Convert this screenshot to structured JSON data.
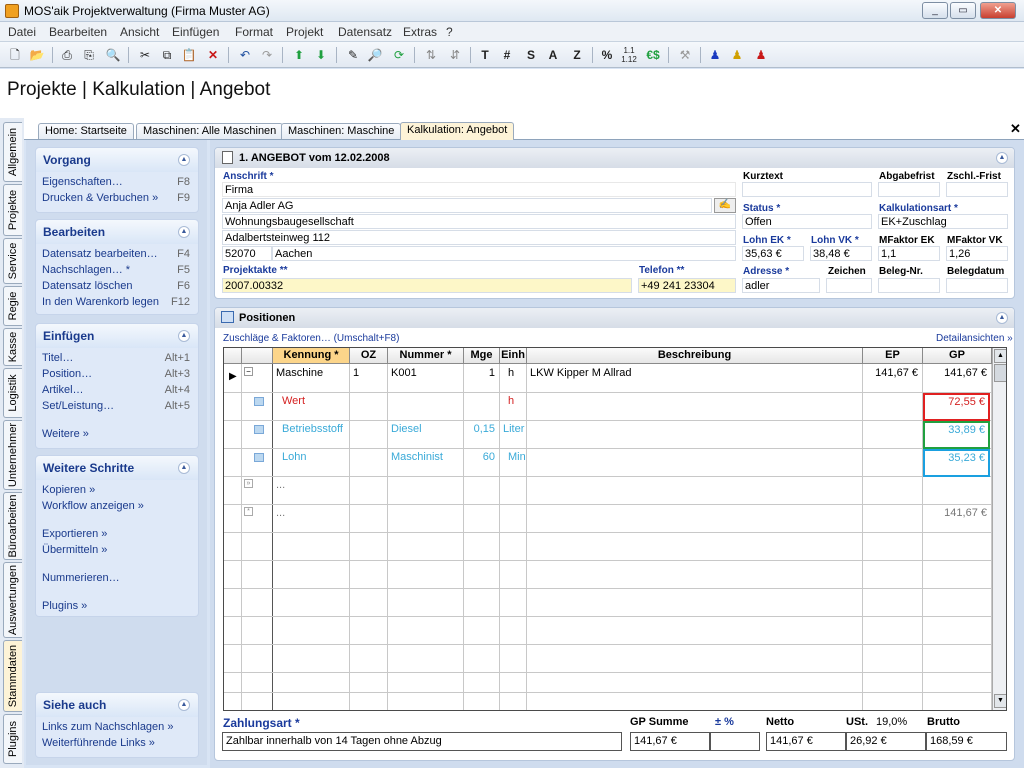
{
  "window": {
    "title": "MOS'aik Projektverwaltung (Firma Muster AG)"
  },
  "menu": [
    "Datei",
    "Bearbeiten",
    "Ansicht",
    "Einfügen",
    "Format",
    "Projekt",
    "Datensatz",
    "Extras",
    "?"
  ],
  "page_title": "Projekte | Kalkulation | Angebot",
  "tabs": [
    "Home: Startseite",
    "Maschinen: Alle Maschinen",
    "Maschinen: Maschine",
    "Kalkulation: Angebot"
  ],
  "vtabs": [
    "Allgemein",
    "Projekte",
    "Service",
    "Regie",
    "Kasse",
    "Logistik",
    "Unternehmer",
    "Büroarbeiten",
    "Auswertungen",
    "Stammdaten",
    "Plugins"
  ],
  "sidebar": {
    "vorgang": {
      "title": "Vorgang",
      "items": [
        {
          "label": "Eigenschaften…",
          "key": "F8"
        },
        {
          "label": "Drucken & Verbuchen »",
          "key": "F9"
        }
      ]
    },
    "bearbeiten": {
      "title": "Bearbeiten",
      "items": [
        {
          "label": "Datensatz bearbeiten…",
          "key": "F4"
        },
        {
          "label": "Nachschlagen… *",
          "key": "F5"
        },
        {
          "label": "Datensatz löschen",
          "key": "F6"
        },
        {
          "label": "In den Warenkorb legen",
          "key": "F12"
        }
      ]
    },
    "einfuegen": {
      "title": "Einfügen",
      "items": [
        {
          "label": "Titel…",
          "key": "Alt+1"
        },
        {
          "label": "Position…",
          "key": "Alt+3"
        },
        {
          "label": "Artikel…",
          "key": "Alt+4"
        },
        {
          "label": "Set/Leistung…",
          "key": "Alt+5"
        },
        {
          "label": "Weitere »",
          "key": ""
        }
      ]
    },
    "weitere": {
      "title": "Weitere Schritte",
      "items": [
        "Kopieren »",
        "Workflow anzeigen »",
        "Exportieren »",
        "Übermitteln »",
        "Nummerieren…",
        "Plugins »"
      ]
    },
    "siehe": {
      "title": "Siehe auch",
      "items": [
        "Links zum Nachschlagen »",
        "Weiterführende Links »"
      ]
    }
  },
  "offer": {
    "heading": "1. ANGEBOT vom 12.02.2008",
    "anschrift_label": "Anschrift *",
    "anschrift": [
      "Firma",
      "Anja Adler AG",
      "Wohnungsbaugesellschaft",
      "Adalbertsteinweg 112"
    ],
    "plz": "52070",
    "ort": "Aachen",
    "projektakte_label": "Projektakte **",
    "projektakte": "2007.00332",
    "telefon_label": "Telefon **",
    "telefon": "+49 241 23304",
    "kurztext_label": "Kurztext",
    "abgabefrist_label": "Abgabefrist",
    "zschl_label": "Zschl.-Frist",
    "status_label": "Status *",
    "status": "Offen",
    "kalkart_label": "Kalkulationsart *",
    "kalkart": "EK+Zuschlag",
    "lohnek_label": "Lohn EK *",
    "lohnek": "35,63 €",
    "lohnvk_label": "Lohn VK *",
    "lohnvk": "38,48 €",
    "mfek_label": "MFaktor EK",
    "mfek": "1,1",
    "mfvk_label": "MFaktor VK",
    "mfvk": "1,26",
    "adresse_label": "Adresse *",
    "adresse": "adler",
    "zeichen_label": "Zeichen",
    "belegnr_label": "Beleg-Nr.",
    "belegdatum_label": "Belegdatum"
  },
  "positions": {
    "heading": "Positionen",
    "zuschlaege": "Zuschläge & Faktoren… (Umschalt+F8)",
    "detail": "Detailansichten »",
    "columns": [
      "Kennung *",
      "OZ",
      "Nummer *",
      "Mge",
      "Einh",
      "Beschreibung",
      "EP",
      "GP"
    ],
    "rows": [
      {
        "kennung": "Maschine",
        "oz": "1",
        "nummer": "K001",
        "mge": "1",
        "einh": "h",
        "beschreibung": "LKW Kipper M Allrad",
        "ep": "141,67 €",
        "gp": "141,67 €"
      },
      {
        "kennung": "Wert",
        "einh": "h",
        "gp": "72,55 €"
      },
      {
        "kennung": "Betriebsstoff",
        "nummer": "Diesel",
        "mge": "0,15",
        "einh": "Liter",
        "gp": "33,89 €"
      },
      {
        "kennung": "Lohn",
        "nummer": "Maschinist",
        "mge": "60",
        "einh": "Min",
        "gp": "35,23 €"
      },
      {
        "kennung": "..."
      },
      {
        "kennung": "...",
        "gp": "141,67 €"
      }
    ]
  },
  "summary": {
    "zahlungsart_label": "Zahlungsart *",
    "zahlungsart": "Zahlbar innerhalb von 14 Tagen ohne Abzug",
    "gpsumme_label": "GP Summe",
    "gpsumme": "141,67 €",
    "pm_label": "± %",
    "pm": "",
    "netto_label": "Netto",
    "netto": "141,67 €",
    "ust_label": "USt.",
    "ust_rate": "19,0%",
    "ust": "26,92 €",
    "brutto_label": "Brutto",
    "brutto": "168,59 €"
  },
  "colors": {
    "accent": "#1a3a9c",
    "highlight_red": "#e02020",
    "highlight_green": "#20a040",
    "highlight_blue": "#1aa0e0"
  }
}
